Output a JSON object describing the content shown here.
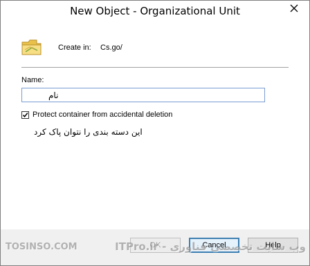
{
  "window": {
    "title": "New Object - Organizational Unit",
    "close_glyph": "✕"
  },
  "create_in": {
    "label": "Create in:",
    "value": "Cs.go/"
  },
  "name": {
    "label": "Name:",
    "value": "نام"
  },
  "protect": {
    "label": "Protect container from accidental deletion",
    "checked": true
  },
  "note": "این دسته بندی را نتوان پاک کرد",
  "buttons": {
    "ok": "OK",
    "cancel": "Cancel",
    "help": "Help"
  },
  "watermark": {
    "left": "TOSINSO.COM",
    "right": "وب سایت تخصصی فناوری - ITPro.ir"
  },
  "colors": {
    "accent": "#3c7fb1",
    "folder": "#f5d76e"
  }
}
